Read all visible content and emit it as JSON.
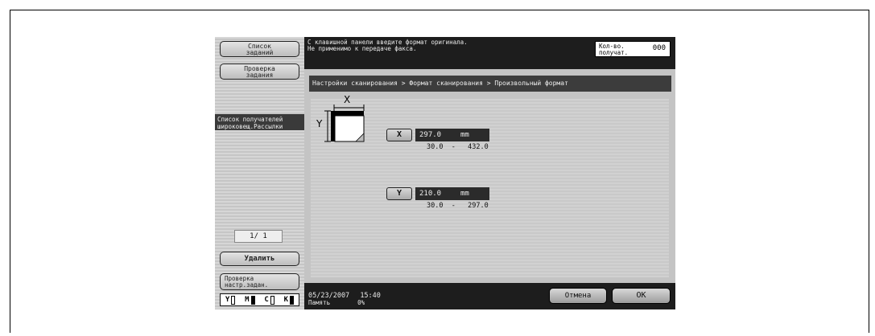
{
  "sidebar": {
    "job_list_label": "Список заданий",
    "job_check_label": "Проверка задания",
    "distribution_label_1": "Список получателей",
    "distribution_label_2": "широковещ.Рассылки",
    "pager": "1/ 1",
    "delete_label": "Удалить",
    "check_settings_label_1": "Проверка",
    "check_settings_label_2": "настр.задан.",
    "toners": [
      "Y",
      "M",
      "C",
      "K"
    ]
  },
  "header": {
    "message": "С клавишной панели введите формат оригинала.\nНе применимо к передаче факса.",
    "copies_label_1": "Кол-во.",
    "copies_label_2": "получат.",
    "copies_value": "000"
  },
  "main": {
    "breadcrumb": "Настройки сканирования > Формат сканирования > Произвольный формат",
    "diagram_x": "X",
    "diagram_y": "Y",
    "x_button": "X",
    "x_value": "297.0",
    "x_unit": "mm",
    "x_range": "30.0  -   432.0",
    "y_button": "Y",
    "y_value": "210.0",
    "y_unit": "mm",
    "y_range": "30.0  -   297.0"
  },
  "footer": {
    "date": "05/23/2007",
    "time": "15:40",
    "memory_label": "Память",
    "memory_value": "0%",
    "cancel_label": "Отмена",
    "ok_label": "OK"
  }
}
